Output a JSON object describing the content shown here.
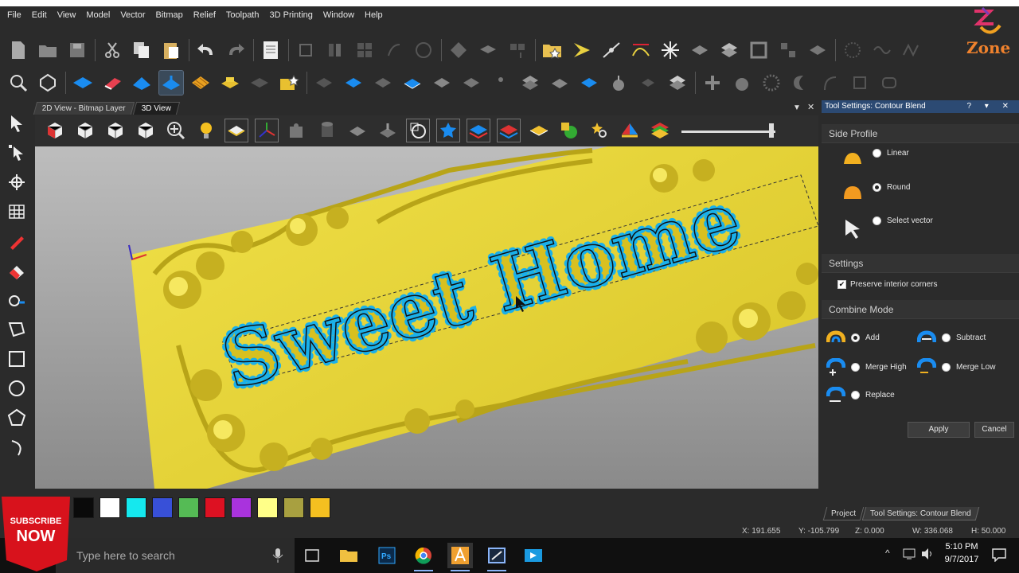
{
  "menu": [
    "File",
    "Edit",
    "View",
    "Model",
    "Vector",
    "Bitmap",
    "Relief",
    "Toolpath",
    "3D Printing",
    "Window",
    "Help"
  ],
  "logo": {
    "text": "Zone"
  },
  "tabs": {
    "bitmap": "2D View - Bitmap Layer",
    "view3d": "3D View"
  },
  "canvas": {
    "engraving": "Sweet Home"
  },
  "panel": {
    "title": "Tool Settings: Contour Blend",
    "controls": "? ▾ ✕",
    "side_profile": {
      "heading": "Side Profile",
      "linear": "Linear",
      "round": "Round",
      "select_vector": "Select vector",
      "selected": "Round"
    },
    "settings": {
      "heading": "Settings",
      "preserve": "Preserve interior corners",
      "preserve_checked": true
    },
    "combine": {
      "heading": "Combine Mode",
      "add": "Add",
      "subtract": "Subtract",
      "merge_high": "Merge High",
      "merge_low": "Merge Low",
      "replace": "Replace",
      "selected": "Add"
    },
    "apply": "Apply",
    "cancel": "Cancel"
  },
  "bottom_tabs": {
    "project": "Project",
    "tool": "Tool Settings: Contour Blend"
  },
  "status": {
    "x": "X: 191.655",
    "y": "Y: -105.799",
    "z": "Z: 0.000",
    "w": "W: 336.068",
    "h": "H: 50.000"
  },
  "palette": [
    "#0a0a0a",
    "#ffffff",
    "#15e8ee",
    "#3850d8",
    "#55bb55",
    "#dd1122",
    "#a933dd",
    "#ffff88",
    "#a8a040",
    "#f5c020"
  ],
  "subscribe": {
    "line1": "SUBSCRIBE",
    "line2": "NOW"
  },
  "taskbar": {
    "search_placeholder": "Type here to search",
    "time": "5:10 PM",
    "date": "9/7/2017"
  },
  "colors": {
    "relief": "#e8d232",
    "vector_node_fill": "#18b8ee",
    "panel_title": "#2c4a73"
  }
}
